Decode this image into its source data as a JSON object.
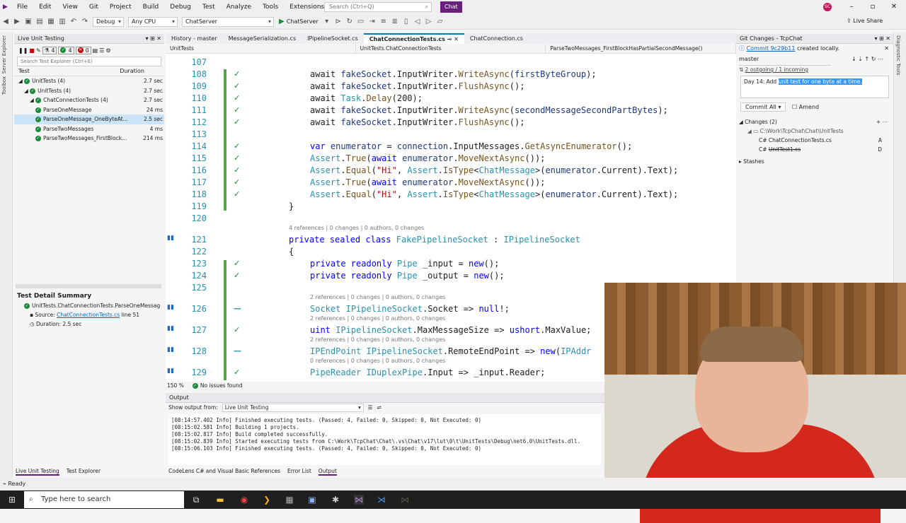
{
  "menubar": {
    "items": [
      "File",
      "Edit",
      "View",
      "Git",
      "Project",
      "Build",
      "Debug",
      "Test",
      "Analyze",
      "Tools",
      "Extensions",
      "Window",
      "Help"
    ],
    "search_placeholder": "Search (Ctrl+Q)",
    "chat_label": "Chat",
    "avatar_initials": "SC"
  },
  "toolbar": {
    "config": "Debug",
    "platform": "Any CPU",
    "startup": "ChatServer",
    "run_label": "ChatServer",
    "live_share": "Live Share"
  },
  "side_strips": {
    "left": [
      "Server Explorer",
      "Toolbox"
    ],
    "right": [
      "Diagnostic Tools"
    ]
  },
  "live_testing": {
    "title": "Live Unit Testing",
    "counts": {
      "total": "4",
      "passed": "4",
      "failed": "0"
    },
    "search_placeholder": "Search Test Explorer (Ctrl+E)",
    "col_test": "Test",
    "col_duration": "Duration",
    "tree": [
      {
        "label": "UnitTests (4)",
        "dur": "2.7 sec",
        "indent": 0
      },
      {
        "label": "UnitTests (4)",
        "dur": "2.7 sec",
        "indent": 1
      },
      {
        "label": "ChatConnectionTests (4)",
        "dur": "2.7 sec",
        "indent": 2
      },
      {
        "label": "ParseOneMessage",
        "dur": "24 ms",
        "indent": 3
      },
      {
        "label": "ParseOneMessage_OneByteAt...",
        "dur": "2.5 sec",
        "indent": 3,
        "selected": true
      },
      {
        "label": "ParseTwoMessages",
        "dur": "4 ms",
        "indent": 3
      },
      {
        "label": "ParseTwoMessages_FirstBlock...",
        "dur": "214 ms",
        "indent": 3
      }
    ]
  },
  "test_detail": {
    "title": "Test Detail Summary",
    "test_name": "UnitTests.ChatConnectionTests.ParseOneMessag",
    "source_label": "Source:",
    "source_file": "ChatConnectionTests.cs",
    "source_line": "line 51",
    "duration": "Duration: 2.5 sec"
  },
  "left_bottom_tabs": [
    "Live Unit Testing",
    "Test Explorer"
  ],
  "editor_tabs": [
    "History - master",
    "MessageSerialization.cs",
    "IPipelineSocket.cs",
    "ChatConnectionTests.cs",
    "ChatConnection.cs"
  ],
  "navbar": {
    "project": "UnitTests",
    "class": "UnitTests.ChatConnectionTests",
    "member": "ParseTwoMessages_FirstBlockHasPartialSecondMessage()"
  },
  "code_lines": [
    {
      "ln": "107",
      "html": ""
    },
    {
      "ln": "108",
      "html": "await <span class='vr'>fakeSocket</span>.InputWriter.<span class='mt'>WriteAsync</span>(<span class='vr'>firstByteGroup</span>);"
    },
    {
      "ln": "109",
      "html": "await <span class='vr'>fakeSocket</span>.InputWriter.<span class='mt'>FlushAsync</span>();"
    },
    {
      "ln": "110",
      "html": "await <span class='ty'>Task</span>.<span class='mt'>Delay</span>(200);"
    },
    {
      "ln": "111",
      "html": "await <span class='vr'>fakeSocket</span>.InputWriter.<span class='mt'>WriteAsync</span>(<span class='vr'>secondMessageSecondPartBytes</span>);"
    },
    {
      "ln": "112",
      "html": "await <span class='vr'>fakeSocket</span>.InputWriter.<span class='mt'>FlushAsync</span>();"
    },
    {
      "ln": "113",
      "html": ""
    },
    {
      "ln": "114",
      "html": "<span class='kw'>var</span> <span class='vr'>enumerator</span> = <span class='vr'>connection</span>.InputMessages.<span class='mt'>GetAsyncEnumerator</span>();"
    },
    {
      "ln": "115",
      "html": "<span class='ty'>Assert</span>.<span class='mt'>True</span>(<span class='kw'>await</span> <span class='vr'>enumerator</span>.<span class='mt'>MoveNextAsync</span>());"
    },
    {
      "ln": "116",
      "html": "<span class='ty'>Assert</span>.<span class='mt'>Equal</span>(<span class='st'>\"Hi\"</span>, <span class='ty'>Assert</span>.<span class='mt'>IsType</span>&lt;<span class='ty'>ChatMessage</span>&gt;(<span class='vr'>enumerator</span>.Current).Text);"
    },
    {
      "ln": "117",
      "html": "<span class='ty'>Assert</span>.<span class='mt'>True</span>(<span class='kw'>await</span> <span class='vr'>enumerator</span>.<span class='mt'>MoveNextAsync</span>());"
    },
    {
      "ln": "118",
      "html": "<span class='ty'>Assert</span>.<span class='mt'>Equal</span>(<span class='st'>\"Hi\"</span>, <span class='ty'>Assert</span>.<span class='mt'>IsType</span>&lt;<span class='ty'>ChatMessage</span>&gt;(<span class='vr'>enumerator</span>.Current).Text);"
    },
    {
      "ln": "119",
      "html": "}"
    },
    {
      "ln": "120",
      "html": ""
    },
    {
      "ln": "121",
      "html": "<span class='kw'>private sealed class</span> <span class='ty'>FakePipelineSocket</span> : <span class='ty'>IPipelineSocket</span>"
    },
    {
      "ln": "122",
      "html": "{"
    },
    {
      "ln": "123",
      "html": "<span class='kw'>private readonly</span> <span class='ty'>Pipe</span> _input = <span class='kw'>new</span>();"
    },
    {
      "ln": "124",
      "html": "<span class='kw'>private readonly</span> <span class='ty'>Pipe</span> _output = <span class='kw'>new</span>();"
    },
    {
      "ln": "125",
      "html": ""
    },
    {
      "ln": "126",
      "html": "<span class='ty'>Socket</span> <span class='ty'>IPipelineSocket</span>.Socket =&gt; <span class='kw'>null</span>!;"
    },
    {
      "ln": "127",
      "html": "<span class='kw'>uint</span> <span class='ty'>IPipelineSocket</span>.MaxMessageSize =&gt; <span class='kw'>ushort</span>.MaxValue;"
    },
    {
      "ln": "128",
      "html": "<span class='ty'>IPEndPoint</span> <span class='ty'>IPipelineSocket</span>.RemoteEndPoint =&gt; <span class='kw'>new</span>(<span class='ty'>IPAddr</span>"
    },
    {
      "ln": "129",
      "html": "<span class='ty'>PipeReader</span> <span class='ty'>IDuplexPipe</span>.Input =&gt; _input.Reader;"
    }
  ],
  "codelens": {
    "class_refs": "4 references | 0 changes | 0 authors, 0 changes",
    "member_refs": "2 references | 0 changes | 0 authors, 0 changes",
    "zero_refs": "0 references | 0 changes | 0 authors, 0 changes"
  },
  "editor_status": {
    "zoom": "150 %",
    "issues": "No issues found"
  },
  "output": {
    "title": "Output",
    "show_from_label": "Show output from:",
    "source": "Live Unit Testing",
    "lines": [
      "[08:14:57.402 Info] Finished executing tests. (Passed: 4, Failed: 0, Skipped: 0, Not Executed: 0)",
      "[08:15:02.581 Info] Building 1 projects.",
      "[08:15:02.817 Info] Build completed successfully.",
      "[08:15:02.839 Info] Started executing tests from C:\\Work\\TcpChat\\Chat\\.vs\\Chat\\v17\\lut\\0\\t\\UnitTests\\Debug\\net6.0\\UnitTests.dll.",
      "[08:15:06.103 Info] Finished executing tests. (Passed: 4, Failed: 0, Skipped: 0, Not Executed: 0)"
    ]
  },
  "bottom_tabs": [
    "CodeLens C# and Visual Basic References",
    "Error List",
    "Output"
  ],
  "git": {
    "title": "Git Changes - TcpChat",
    "notice_prefix": "Commit 9c29b11",
    "notice_suffix": "created locally.",
    "branch": "master",
    "sync": "2 outgoing / 1 incoming",
    "message_prefix": "Day 14: Add ",
    "message_selected": "unit test for one byte at a time.",
    "commit_all": "Commit All",
    "amend": "Amend",
    "changes_header": "Changes (2)",
    "folder": "C:\\Work\\TcpChat\\Chat\\UnitTests",
    "files": [
      {
        "name": "ChatConnectionTests.cs",
        "status": "A"
      },
      {
        "name": "UnitTest1.cs",
        "status": "D"
      }
    ],
    "stashes": "Stashes"
  },
  "statusbar": {
    "text": "Ready"
  },
  "taskbar": {
    "search_placeholder": "Type here to search"
  },
  "colors": {
    "accent": "#68217a",
    "pass": "#1b8a3a",
    "change_bar": "#57a64a",
    "selection": "#3399ff"
  }
}
